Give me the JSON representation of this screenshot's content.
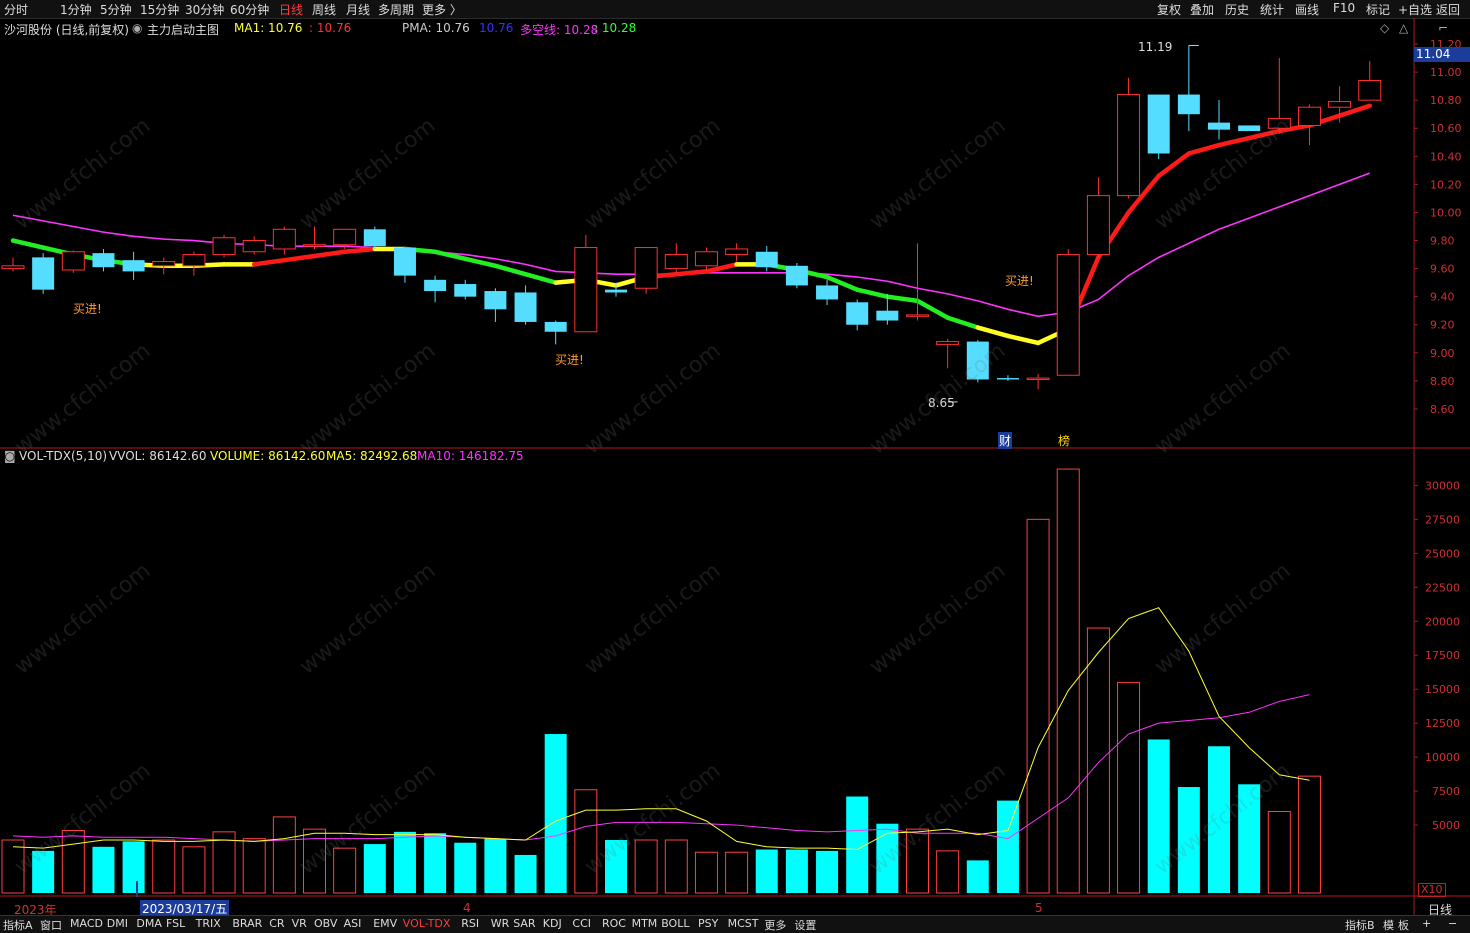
{
  "toolbar": {
    "periods": [
      "分时",
      "1分钟",
      "5分钟",
      "15分钟",
      "30分钟",
      "60分钟",
      "日线",
      "周线",
      "月线",
      "多周期",
      "更多 〉"
    ],
    "active_period": "日线",
    "right_tools": [
      "复权",
      "叠加",
      "历史",
      "统计",
      "画线",
      "F10",
      "标记",
      "+自选",
      "返回"
    ]
  },
  "header": {
    "stock": "沙河股份 (日线,前复权)",
    "indicator": "主力启动主图",
    "ma1_label": "MA1: 10.76",
    "ma1_value": ": 10.76",
    "pma_label": "PMA: 10.76",
    "pma_value": "10.76",
    "dk_label": "多空线: 10.28",
    "dk_value": ": 10.28"
  },
  "vol_header": {
    "name": "VOL-TDX(5,10)",
    "vvol": "VVOL: 86142.60",
    "volume": "VOLUME: 86142.60",
    "ma5": "MA5: 82492.68",
    "ma10": "MA10: 146182.75"
  },
  "current_price_tag": "11.04",
  "x10_label": "X10",
  "date_labels": {
    "year": "2023年",
    "cursor_date": "2023/03/17/五",
    "apr": "4",
    "may": "5",
    "period": "日线"
  },
  "bottombar": {
    "left_label": "指标A",
    "items": [
      "窗口",
      "MACD",
      "DMI",
      "DMA",
      "FSL",
      "TRIX",
      "BRAR",
      "CR",
      "VR",
      "OBV",
      "ASI",
      "EMV",
      "VOL-TDX",
      "RSI",
      "WR",
      "SAR",
      "KDJ",
      "CCI",
      "ROC",
      "MTM",
      "BOLL",
      "PSY",
      "MCST",
      "更多",
      "设置"
    ],
    "active": "VOL-TDX",
    "right_items": [
      "指标B",
      "模",
      "板",
      "+",
      "−"
    ]
  },
  "watermark": "www.cfchi.com",
  "annotations": {
    "buy": "买进!",
    "high": "11.19",
    "low": "8.65",
    "cai": "财",
    "bang": "榜"
  },
  "colors": {
    "up": "#ff3030",
    "down_cyan": "#55ddff",
    "vol_down": "#00ffff",
    "ma_line": "#ff33ff",
    "ma5_vol": "#ffff33",
    "bg": "#000000",
    "axis": "#c02020"
  },
  "chart_data": [
    {
      "type": "candlestick",
      "title": "沙河股份 (日线,前复权)",
      "ylim": [
        8.45,
        11.3
      ],
      "yticks": [
        8.6,
        8.8,
        9.0,
        9.2,
        9.4,
        9.6,
        9.8,
        10.0,
        10.2,
        10.4,
        10.6,
        10.8,
        11.0,
        11.2
      ],
      "ohlc": [
        [
          9.6,
          9.68,
          9.58,
          9.62
        ],
        [
          9.68,
          9.71,
          9.42,
          9.45
        ],
        [
          9.59,
          9.73,
          9.57,
          9.72
        ],
        [
          9.71,
          9.74,
          9.58,
          9.61
        ],
        [
          9.66,
          9.72,
          9.52,
          9.58
        ],
        [
          9.62,
          9.68,
          9.56,
          9.65
        ],
        [
          9.62,
          9.72,
          9.55,
          9.7
        ],
        [
          9.7,
          9.84,
          9.68,
          9.82
        ],
        [
          9.72,
          9.83,
          9.7,
          9.8
        ],
        [
          9.74,
          9.9,
          9.7,
          9.88
        ],
        [
          9.76,
          9.9,
          9.74,
          9.77
        ],
        [
          9.77,
          9.88,
          9.74,
          9.88
        ],
        [
          9.88,
          9.9,
          9.74,
          9.76
        ],
        [
          9.75,
          9.75,
          9.5,
          9.55
        ],
        [
          9.52,
          9.55,
          9.36,
          9.44
        ],
        [
          9.49,
          9.52,
          9.38,
          9.4
        ],
        [
          9.44,
          9.46,
          9.22,
          9.31
        ],
        [
          9.43,
          9.48,
          9.2,
          9.22
        ],
        [
          9.22,
          9.23,
          9.06,
          9.15
        ],
        [
          9.15,
          9.84,
          9.15,
          9.75
        ],
        [
          9.45,
          9.5,
          9.4,
          9.43
        ],
        [
          9.46,
          9.74,
          9.42,
          9.75
        ],
        [
          9.6,
          9.78,
          9.57,
          9.7
        ],
        [
          9.62,
          9.75,
          9.58,
          9.72
        ],
        [
          9.7,
          9.78,
          9.65,
          9.74
        ],
        [
          9.72,
          9.76,
          9.58,
          9.61
        ],
        [
          9.62,
          9.64,
          9.46,
          9.48
        ],
        [
          9.48,
          9.52,
          9.34,
          9.38
        ],
        [
          9.36,
          9.38,
          9.16,
          9.2
        ],
        [
          9.3,
          9.42,
          9.2,
          9.23
        ],
        [
          9.26,
          9.78,
          9.23,
          9.27
        ],
        [
          9.06,
          9.1,
          8.89,
          9.08
        ],
        [
          9.08,
          9.09,
          8.79,
          8.81
        ],
        [
          8.82,
          8.84,
          8.8,
          8.81
        ],
        [
          8.81,
          8.85,
          8.74,
          8.82
        ],
        [
          8.84,
          9.74,
          8.84,
          9.7
        ],
        [
          9.7,
          10.25,
          9.68,
          10.12
        ],
        [
          10.12,
          10.96,
          10.1,
          10.84
        ],
        [
          10.84,
          10.84,
          10.38,
          10.42
        ],
        [
          10.84,
          11.19,
          10.58,
          10.7
        ],
        [
          10.64,
          10.8,
          10.52,
          10.59
        ],
        [
          10.62,
          10.62,
          10.58,
          10.58
        ],
        [
          10.6,
          11.1,
          10.56,
          10.67
        ],
        [
          10.62,
          10.77,
          10.48,
          10.75
        ],
        [
          10.75,
          10.9,
          10.64,
          10.79
        ],
        [
          10.8,
          11.08,
          10.8,
          10.94
        ]
      ],
      "series": [
        {
          "name": "MA1",
          "values": [
            9.8,
            9.75,
            9.7,
            9.66,
            9.63,
            9.62,
            9.62,
            9.63,
            9.63,
            9.66,
            9.69,
            9.72,
            9.74,
            9.74,
            9.72,
            9.67,
            9.62,
            9.56,
            9.5,
            9.52,
            9.48,
            9.54,
            9.56,
            9.58,
            9.63,
            9.63,
            9.59,
            9.54,
            9.45,
            9.4,
            9.37,
            9.25,
            9.18,
            9.12,
            9.07,
            9.17,
            9.68,
            10.0,
            10.26,
            10.42,
            10.48,
            10.53,
            10.58,
            10.62,
            10.69,
            10.76
          ]
        },
        {
          "name": "多空线",
          "values": [
            9.98,
            9.94,
            9.9,
            9.86,
            9.83,
            9.81,
            9.8,
            9.78,
            9.77,
            9.76,
            9.76,
            9.76,
            9.75,
            9.74,
            9.72,
            9.7,
            9.67,
            9.63,
            9.58,
            9.57,
            9.56,
            9.56,
            9.56,
            9.57,
            9.57,
            9.57,
            9.57,
            9.56,
            9.54,
            9.51,
            9.46,
            9.42,
            9.37,
            9.31,
            9.26,
            9.29,
            9.38,
            9.55,
            9.68,
            9.78,
            9.88,
            9.96,
            10.04,
            10.12,
            10.2,
            10.28
          ]
        }
      ]
    },
    {
      "type": "bar",
      "title": "VOL-TDX(5,10)",
      "ylim": [
        0,
        31500
      ],
      "yticks": [
        5000,
        7500,
        10000,
        12500,
        15000,
        17500,
        20000,
        22500,
        25000,
        27500,
        30000
      ],
      "unit": "X10",
      "values": [
        3900,
        3100,
        4600,
        3400,
        3800,
        3900,
        3400,
        4500,
        4000,
        5600,
        4700,
        3300,
        3600,
        4500,
        4400,
        3700,
        4000,
        2800,
        11700,
        7600,
        3900,
        3900,
        3900,
        3000,
        3000,
        3200,
        3200,
        3100,
        7100,
        5100,
        4700,
        3100,
        2400,
        6800,
        27500,
        31200,
        19500,
        15500,
        11300,
        7800,
        10800,
        8000,
        6000,
        8600
      ],
      "series": [
        {
          "name": "MA5",
          "values": [
            3400,
            3300,
            3600,
            3900,
            3900,
            3800,
            3800,
            3900,
            3800,
            4000,
            4400,
            4400,
            4300,
            4300,
            4300,
            4100,
            4000,
            3900,
            5300,
            6100,
            6100,
            6200,
            6200,
            5300,
            3800,
            3400,
            3300,
            3300,
            3200,
            4400,
            4500,
            4700,
            4300,
            4600,
            10700,
            14900,
            17700,
            20200,
            21000,
            17800,
            13000,
            10700,
            8700,
            8300
          ]
        },
        {
          "name": "MA10",
          "values": [
            4200,
            4100,
            4200,
            4100,
            4100,
            4100,
            4000,
            3900,
            3800,
            3900,
            4000,
            4000,
            4000,
            4100,
            4200,
            4100,
            4000,
            3900,
            4200,
            4900,
            5200,
            5200,
            5200,
            5100,
            5000,
            4800,
            4600,
            4500,
            4600,
            4700,
            4400,
            4400,
            4400,
            4000,
            5500,
            7000,
            9600,
            11700,
            12500,
            12700,
            12900,
            13300,
            14100,
            14600
          ]
        }
      ]
    }
  ]
}
